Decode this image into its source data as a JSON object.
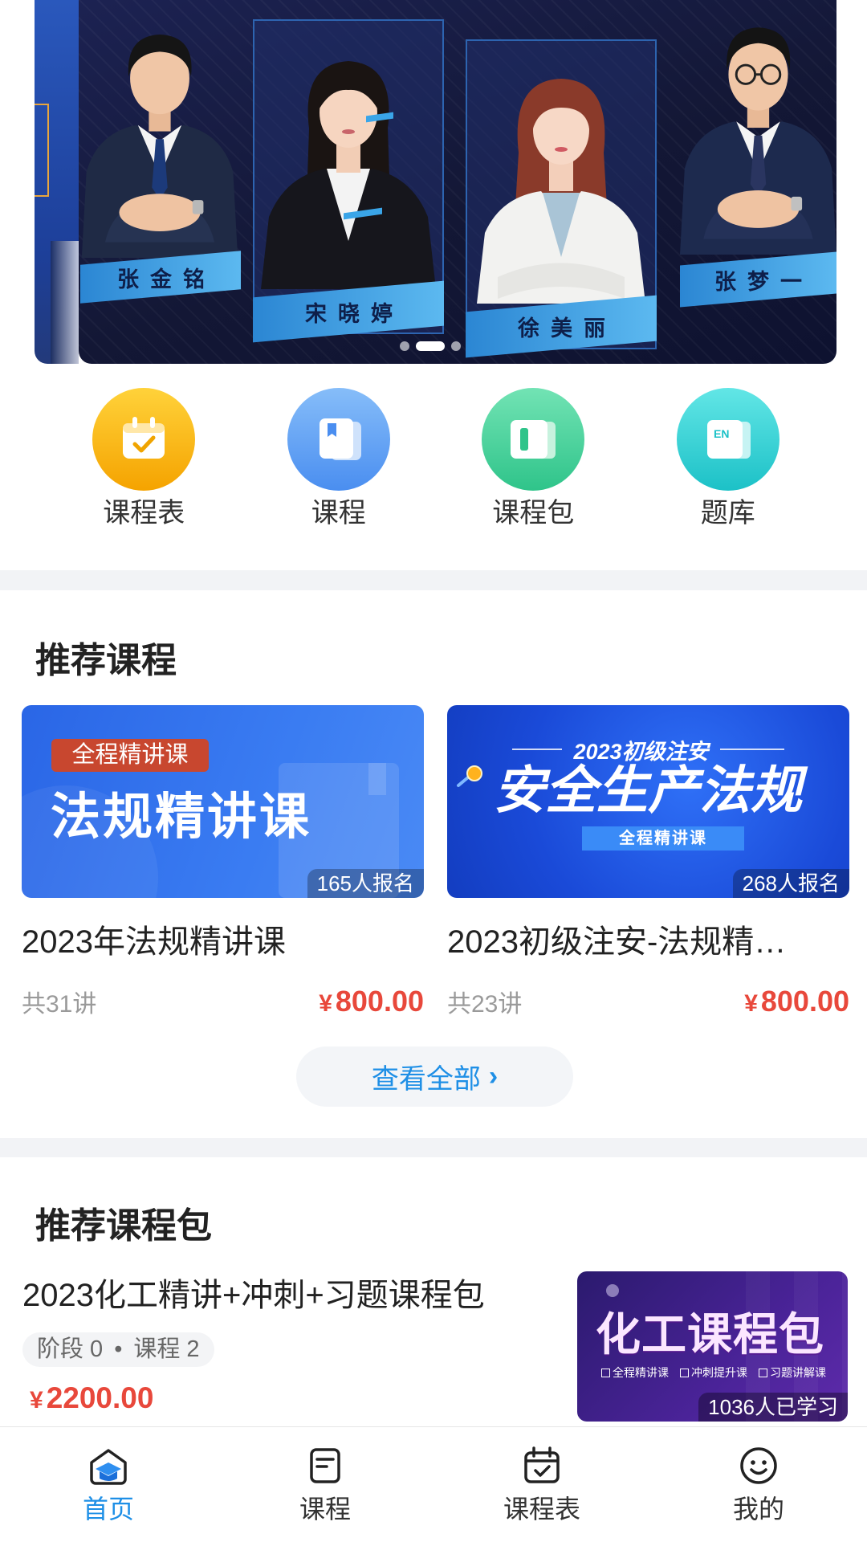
{
  "banner": {
    "teachers": [
      {
        "name": "张金铭"
      },
      {
        "name": "宋晓婷"
      },
      {
        "name": "徐美丽"
      },
      {
        "name": "张梦一"
      }
    ],
    "carousel": {
      "count": 3,
      "active_index": 1
    }
  },
  "shortcuts": [
    {
      "label": "课程表",
      "icon": "calendar-check-icon",
      "color": "#f7b31d"
    },
    {
      "label": "课程",
      "icon": "book-icon",
      "color": "#5b9bf3"
    },
    {
      "label": "课程包",
      "icon": "open-book-icon",
      "color": "#3fcf95"
    },
    {
      "label": "题库",
      "icon": "en-book-icon",
      "icon_text": "EN",
      "color": "#2ccfd0"
    }
  ],
  "recommended_courses": {
    "title": "推荐课程",
    "items": [
      {
        "cover": {
          "badge": "全程精讲课",
          "headline": "法规精讲课"
        },
        "enrolled": "165人报名",
        "title": "2023年法规精讲课",
        "lessons": "共31讲",
        "currency": "¥",
        "price": "800.00"
      },
      {
        "cover": {
          "kicker": "2023初级注安",
          "headline": "安全生产法规",
          "subtitle": "全程精讲课"
        },
        "enrolled": "268人报名",
        "title": "2023初级注安-法规精…",
        "lessons": "共23讲",
        "currency": "¥",
        "price": "800.00"
      }
    ],
    "view_all": "查看全部",
    "view_all_chevron": "›"
  },
  "recommended_packages": {
    "title": "推荐课程包",
    "items": [
      {
        "title": "2023化工精讲+冲刺+习题课程包",
        "stage": "阶段 0",
        "separator": "•",
        "courses": "课程 2",
        "currency": "¥",
        "price": "2200.00",
        "cover": {
          "headline": "化工课程包",
          "features": [
            "全程精讲课",
            "冲刺提升课",
            "习题讲解课"
          ],
          "learners": "1036人已学习"
        }
      }
    ]
  },
  "bottom_nav": {
    "active_index": 0,
    "items": [
      {
        "label": "首页",
        "icon": "home-icon"
      },
      {
        "label": "课程",
        "icon": "document-icon"
      },
      {
        "label": "课程表",
        "icon": "calendar-check-icon"
      },
      {
        "label": "我的",
        "icon": "smiley-icon"
      }
    ]
  },
  "colors": {
    "accent": "#1e8fe6",
    "price": "#e8483b",
    "separator": "#f2f3f6"
  }
}
